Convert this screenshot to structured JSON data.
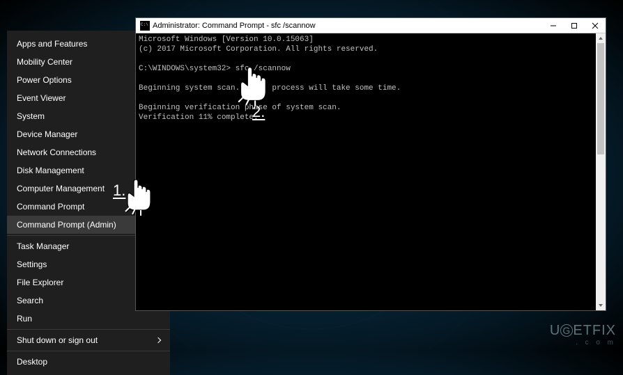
{
  "winx": {
    "groups": [
      [
        {
          "label": "Apps and Features"
        },
        {
          "label": "Mobility Center"
        },
        {
          "label": "Power Options"
        },
        {
          "label": "Event Viewer"
        },
        {
          "label": "System"
        },
        {
          "label": "Device Manager"
        },
        {
          "label": "Network Connections"
        },
        {
          "label": "Disk Management"
        },
        {
          "label": "Computer Management"
        },
        {
          "label": "Command Prompt"
        },
        {
          "label": "Command Prompt (Admin)",
          "hover": true
        }
      ],
      [
        {
          "label": "Task Manager"
        },
        {
          "label": "Settings"
        },
        {
          "label": "File Explorer"
        },
        {
          "label": "Search"
        },
        {
          "label": "Run"
        }
      ],
      [
        {
          "label": "Shut down or sign out",
          "submenu": true
        }
      ],
      [
        {
          "label": "Desktop"
        }
      ]
    ]
  },
  "cmd": {
    "title": "Administrator: Command Prompt - sfc  /scannow",
    "lines": [
      "Microsoft Windows [Version 10.0.15063]",
      "(c) 2017 Microsoft Corporation. All rights reserved.",
      "",
      "C:\\WINDOWS\\system32> sfc /scannow",
      "",
      "Beginning system scan.  This process will take some time.",
      "",
      "Beginning verification phase of system scan.",
      "Verification 11% complete."
    ]
  },
  "annotations": {
    "one": "1.",
    "two": "2."
  },
  "watermark": {
    "pre": "U",
    "g": "G",
    "post": "ETFIX"
  }
}
